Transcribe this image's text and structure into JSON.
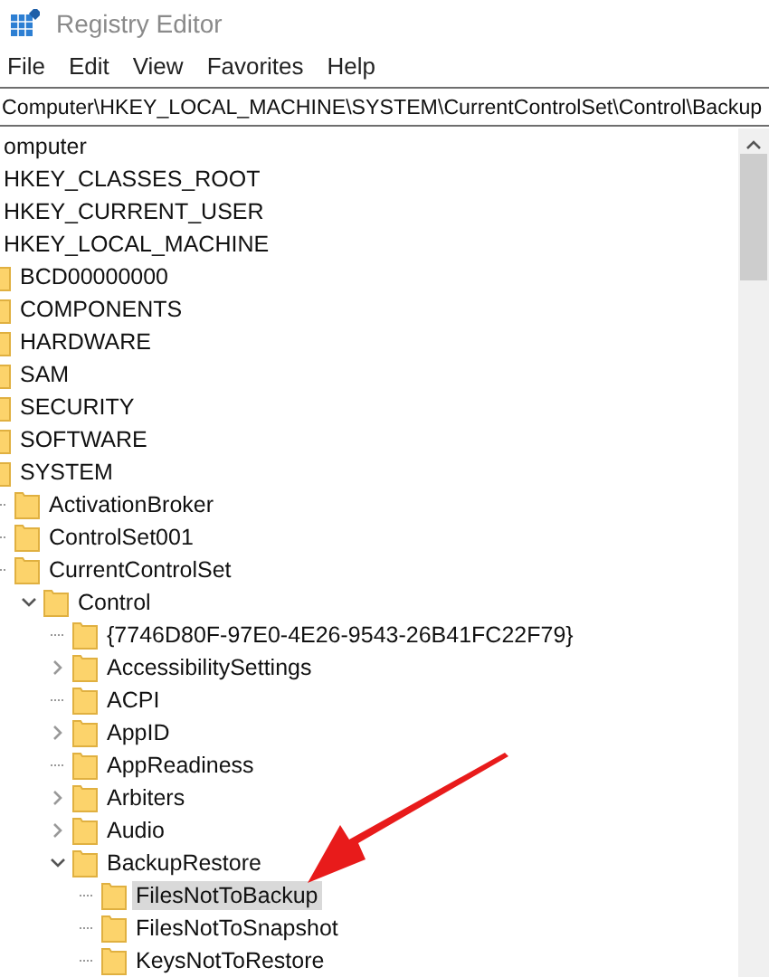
{
  "window": {
    "title": "Registry Editor"
  },
  "menu": [
    "File",
    "Edit",
    "View",
    "Favorites",
    "Help"
  ],
  "address": "Computer\\HKEY_LOCAL_MACHINE\\SYSTEM\\CurrentControlSet\\Control\\Backup",
  "tree": [
    {
      "name": "omputer",
      "selected": false,
      "children": [
        {
          "name": "HKEY_CLASSES_ROOT",
          "selected": false
        },
        {
          "name": "HKEY_CURRENT_USER",
          "selected": false
        },
        {
          "name": "HKEY_LOCAL_MACHINE",
          "selected": false,
          "children": [
            {
              "name": "BCD00000000",
              "selected": false
            },
            {
              "name": "COMPONENTS",
              "selected": false
            },
            {
              "name": "HARDWARE",
              "selected": false
            },
            {
              "name": "SAM",
              "selected": false
            },
            {
              "name": "SECURITY",
              "selected": false
            },
            {
              "name": "SOFTWARE",
              "selected": false
            },
            {
              "name": "SYSTEM",
              "selected": false,
              "children": [
                {
                  "name": "ActivationBroker",
                  "selected": false
                },
                {
                  "name": "ControlSet001",
                  "selected": false
                },
                {
                  "name": "CurrentControlSet",
                  "selected": false,
                  "children": [
                    {
                      "name": "Control",
                      "expanded": true,
                      "selected": false,
                      "children": [
                        {
                          "name": "{7746D80F-97E0-4E26-9543-26B41FC22F79}",
                          "selected": false
                        },
                        {
                          "name": "AccessibilitySettings",
                          "expanded": false,
                          "selected": false
                        },
                        {
                          "name": "ACPI",
                          "selected": false
                        },
                        {
                          "name": "AppID",
                          "expanded": false,
                          "selected": false
                        },
                        {
                          "name": "AppReadiness",
                          "selected": false
                        },
                        {
                          "name": "Arbiters",
                          "expanded": false,
                          "selected": false
                        },
                        {
                          "name": "Audio",
                          "expanded": false,
                          "selected": false
                        },
                        {
                          "name": "BackupRestore",
                          "expanded": true,
                          "selected": false,
                          "children": [
                            {
                              "name": "FilesNotToBackup",
                              "selected": true
                            },
                            {
                              "name": "FilesNotToSnapshot",
                              "selected": false
                            },
                            {
                              "name": "KeysNotToRestore",
                              "selected": false
                            }
                          ]
                        }
                      ]
                    }
                  ]
                }
              ]
            }
          ]
        }
      ]
    }
  ]
}
